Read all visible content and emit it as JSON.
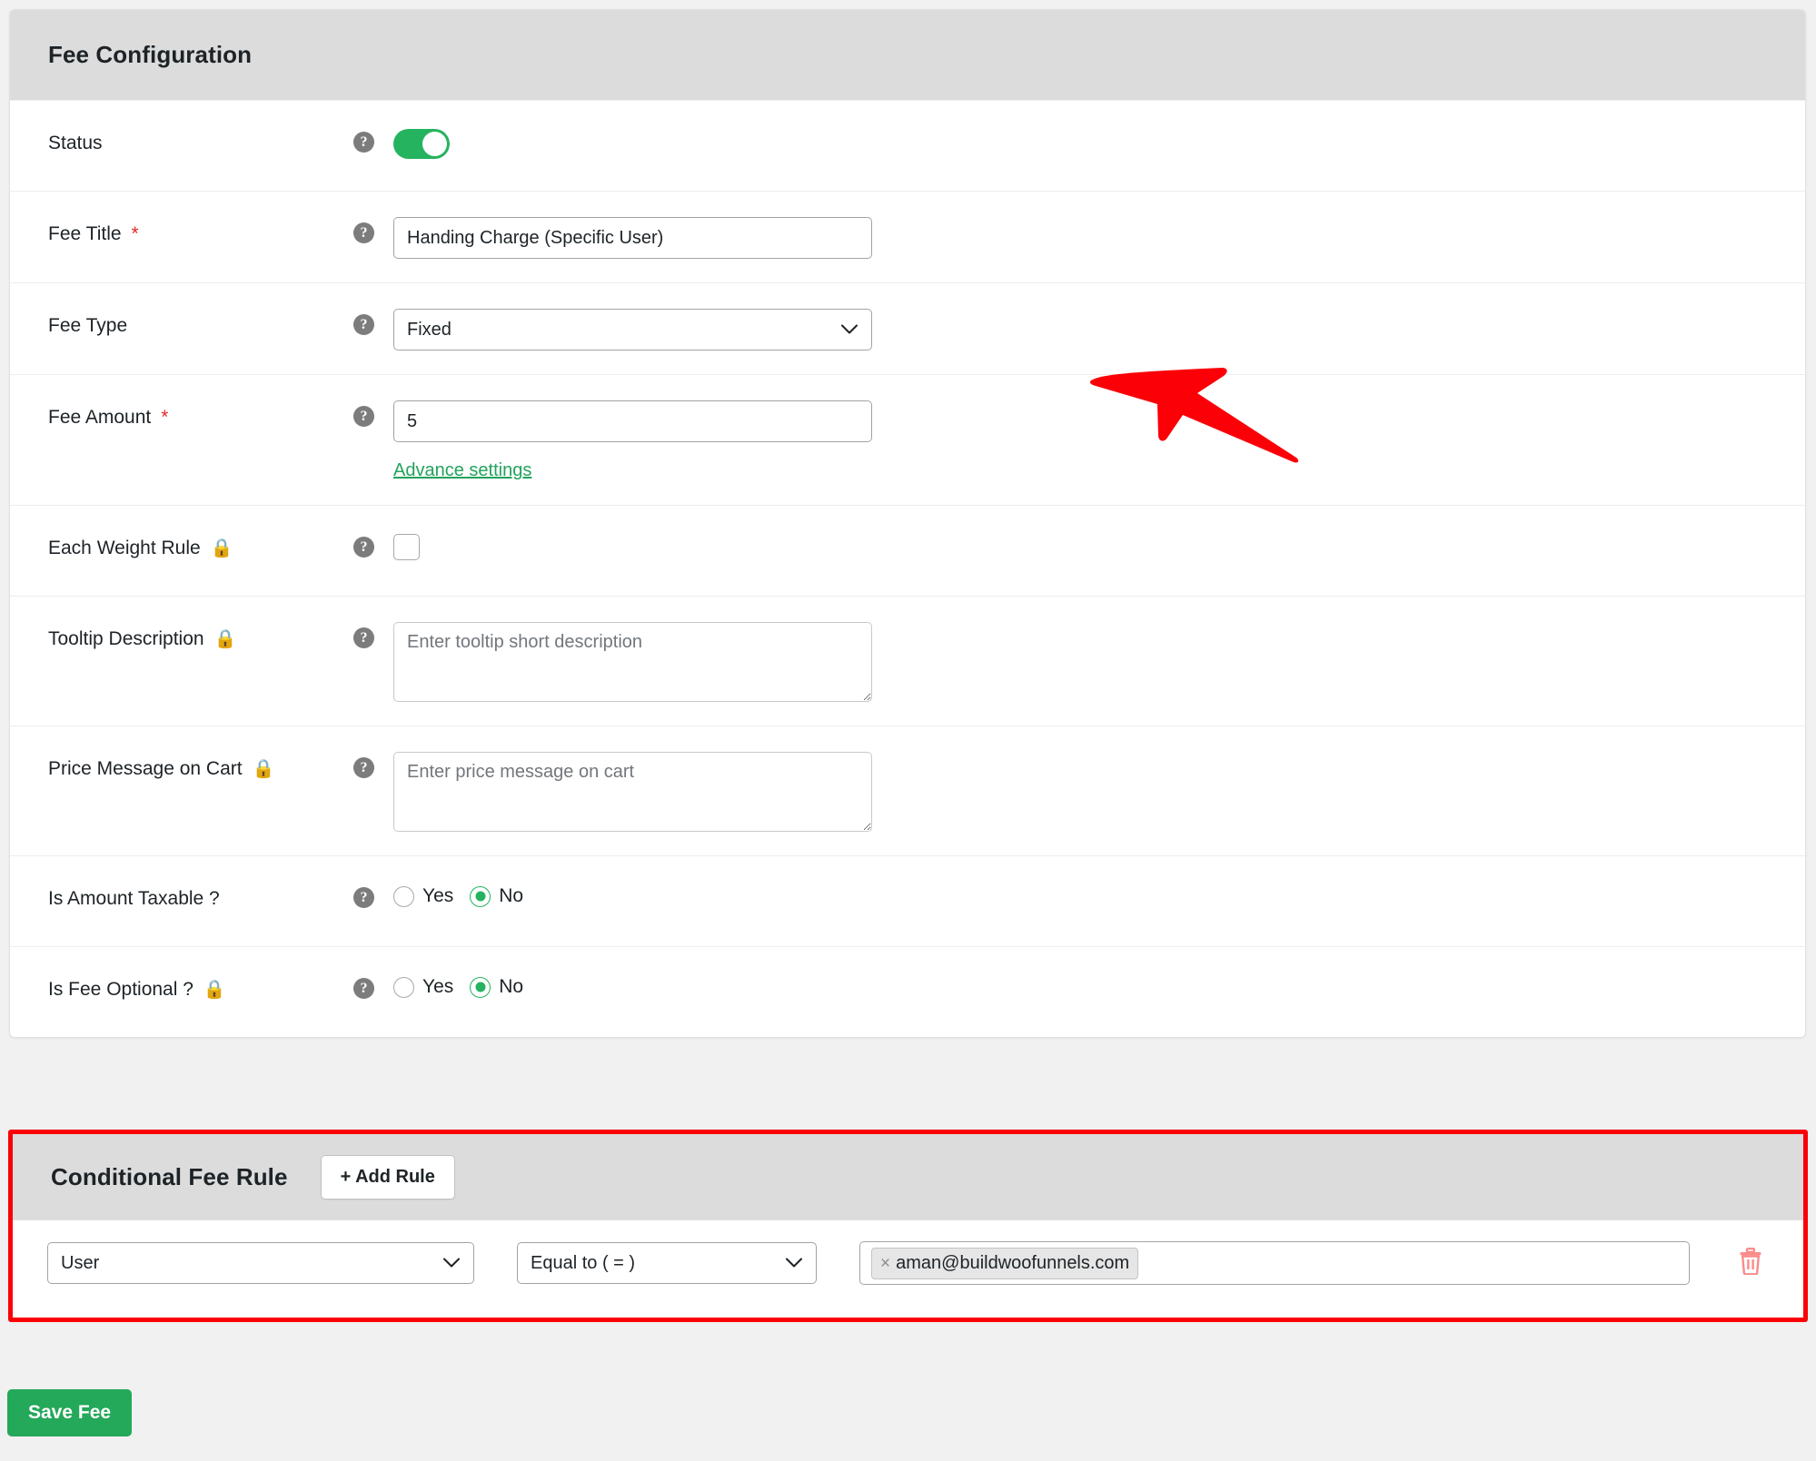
{
  "fee_configuration": {
    "title": "Fee Configuration",
    "rows": {
      "status": {
        "label": "Status",
        "help": "?",
        "toggle_on": true
      },
      "fee_title": {
        "label": "Fee Title",
        "required_mark": "*",
        "help": "?",
        "value": "Handing Charge (Specific User)"
      },
      "fee_type": {
        "label": "Fee Type",
        "help": "?",
        "value": "Fixed",
        "options": [
          "Fixed"
        ]
      },
      "fee_amount": {
        "label": "Fee Amount",
        "required_mark": "*",
        "help": "?",
        "value": "5",
        "advance_settings_link": "Advance settings"
      },
      "each_weight_rule": {
        "label": "Each Weight Rule",
        "lock": "🔒",
        "help": "?",
        "checked": false
      },
      "tooltip_description": {
        "label": "Tooltip Description",
        "lock": "🔒",
        "help": "?",
        "value": "",
        "placeholder": "Enter tooltip short description"
      },
      "price_message_on_cart": {
        "label": "Price Message on Cart",
        "lock": "🔒",
        "help": "?",
        "value": "",
        "placeholder": "Enter price message on cart"
      },
      "is_amount_taxable": {
        "label": "Is Amount Taxable ?",
        "help": "?",
        "option_yes": "Yes",
        "option_no": "No",
        "selected": "No"
      },
      "is_fee_optional": {
        "label": "Is Fee Optional ?",
        "lock": "🔒",
        "help": "?",
        "option_yes": "Yes",
        "option_no": "No",
        "selected": "No"
      }
    }
  },
  "conditional_fee_rule": {
    "title": "Conditional Fee Rule",
    "add_rule_label": "+ Add Rule",
    "highlight_color": "#fb0007",
    "rules": [
      {
        "field": "User",
        "operator": "Equal to ( = )",
        "tags": [
          {
            "remove_glyph": "×",
            "text": "aman@buildwoofunnels.com"
          }
        ],
        "delete_icon": "trash-icon"
      }
    ]
  },
  "footer": {
    "save_label": "Save Fee",
    "save_color": "#24a85a"
  },
  "annotations": {
    "arrow": {
      "color": "#fb0007",
      "points_to": "fee-amount-input"
    }
  }
}
